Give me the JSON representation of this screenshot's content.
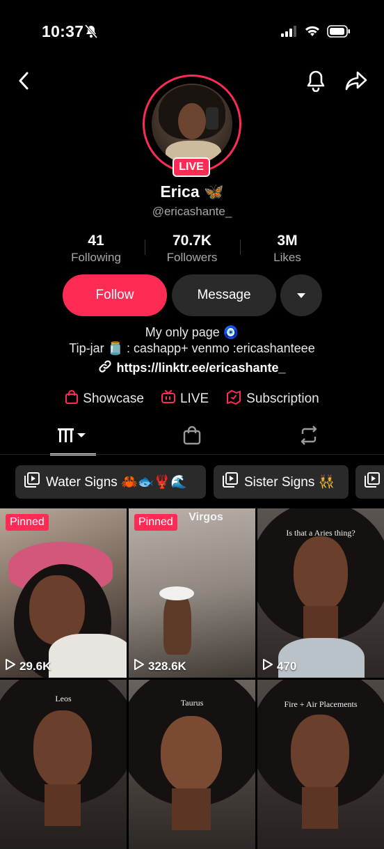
{
  "status": {
    "time": "10:37"
  },
  "profile": {
    "display_name": "Erica 🦋",
    "username": "@ericashante_",
    "live_badge": "LIVE"
  },
  "stats": [
    {
      "value": "41",
      "label": "Following"
    },
    {
      "value": "70.7K",
      "label": "Followers"
    },
    {
      "value": "3M",
      "label": "Likes"
    }
  ],
  "actions": {
    "follow": "Follow",
    "message": "Message"
  },
  "bio": {
    "line1": "My only page 🧿",
    "line2": "Tip-jar 🫙 : cashapp+ venmo :ericashanteee",
    "link": "https://linktr.ee/ericashante_"
  },
  "features": [
    {
      "label": "Showcase",
      "icon": "shopping-bag-icon"
    },
    {
      "label": "LIVE",
      "icon": "tv-icon"
    },
    {
      "label": "Subscription",
      "icon": "subscription-icon"
    }
  ],
  "tabs": [
    {
      "name": "videos",
      "icon": "grid-icon",
      "active": true
    },
    {
      "name": "shop",
      "icon": "bag-icon"
    },
    {
      "name": "reposts",
      "icon": "repost-icon"
    }
  ],
  "playlists": [
    {
      "label": "Water Signs 🦀🐟🦞🌊"
    },
    {
      "label": "Sister Signs 👯‍♀️"
    }
  ],
  "videos": [
    {
      "pinned": "Pinned",
      "views": "29.6K",
      "caption": ""
    },
    {
      "pinned": "Pinned",
      "views": "328.6K",
      "caption": "Virgos"
    },
    {
      "pinned": "",
      "views": "470",
      "caption": "Is that a Aries thing?"
    },
    {
      "pinned": "",
      "views": "",
      "caption": "Leos"
    },
    {
      "pinned": "",
      "views": "",
      "caption": "Taurus"
    },
    {
      "pinned": "",
      "views": "",
      "caption": "Fire + Air Placements"
    }
  ],
  "colors": {
    "accent": "#fe2c55",
    "background": "#000000",
    "secondary_button": "#2a2a2a"
  }
}
